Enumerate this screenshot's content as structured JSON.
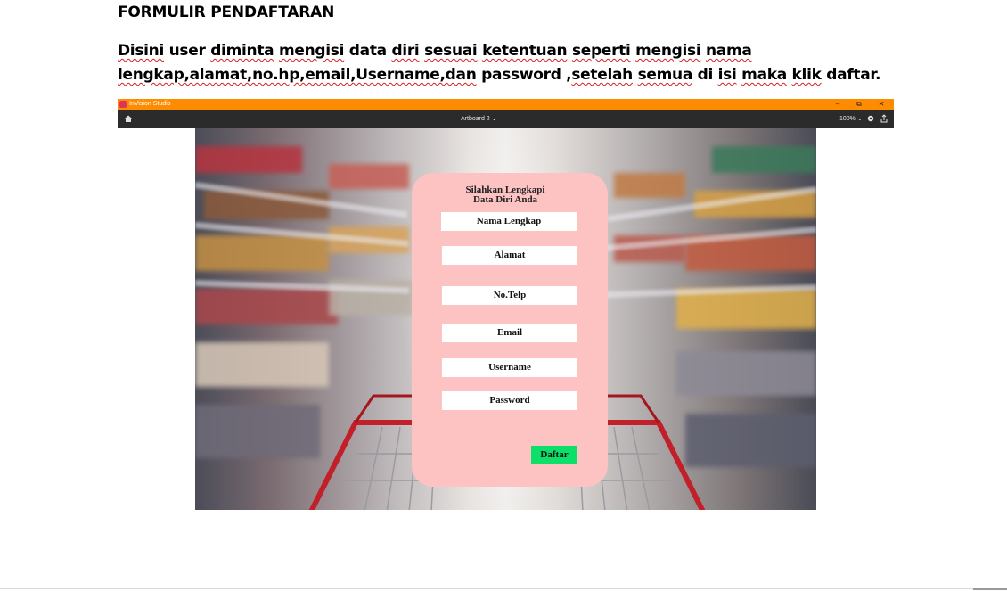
{
  "document": {
    "heading": "FORMULIR PENDAFTARAN",
    "description_parts": [
      "Disini",
      " user ",
      "diminta",
      " ",
      "mengisi",
      " data ",
      "diri",
      " ",
      "sesuai",
      " ",
      "ketentuan",
      " ",
      "seperti",
      " ",
      "mengisi",
      " ",
      "nama",
      " ",
      "lengkap,alamat,no.hp,email,Username,dan",
      " password ,",
      "setelah",
      " ",
      "semua",
      " di ",
      "isi",
      " ",
      "maka",
      " ",
      "klik",
      " daftar."
    ]
  },
  "app": {
    "name": "InVision Studio",
    "window_controls": {
      "minimize": "–",
      "restore": "⧉",
      "close": "✕"
    },
    "artboard_selector": "Artboard 2 ⌄",
    "zoom": "100% ⌄",
    "icons": [
      "home-icon",
      "settings-icon",
      "share-icon"
    ]
  },
  "form": {
    "title_line1": "Silahkan Lengkapi",
    "title_line2": "Data Diri Anda",
    "fields": [
      "Nama Lengkap",
      "Alamat",
      "No.Telp",
      "Email",
      "Username",
      "Password"
    ],
    "submit_label": "Daftar"
  },
  "colors": {
    "titlebar": "#ff8c00",
    "toolbar": "#2b2b2b",
    "card": "#fdc3c2",
    "submit": "#0de068",
    "spellcheck": "#d42020"
  }
}
